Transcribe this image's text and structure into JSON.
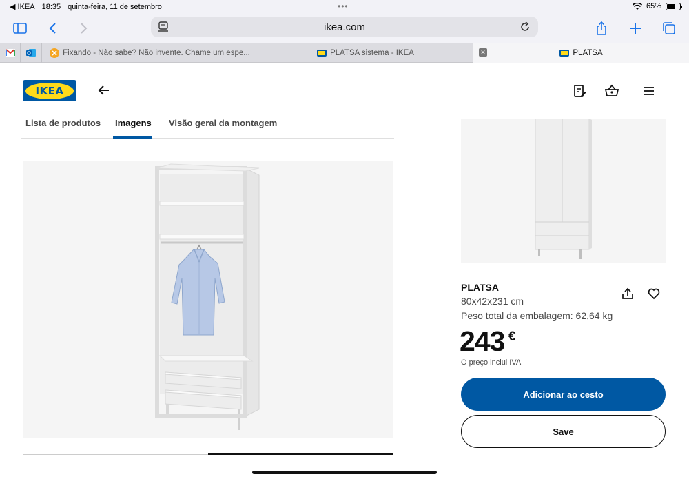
{
  "status": {
    "back_app": "◀ IKEA",
    "time": "18:35",
    "date": "quinta-feira, 11 de setembro",
    "battery": "65%",
    "battery_level": 0.65
  },
  "browser": {
    "url": "ikea.com",
    "tabs": [
      {
        "title": "",
        "favicon": "gmail"
      },
      {
        "title": "",
        "favicon": "outlook"
      },
      {
        "title": "Fixando - Não sabe? Não invente. Chame um espe...",
        "favicon": "fixando"
      },
      {
        "title": "PLATSA sistema - IKEA",
        "favicon": "ikea"
      },
      {
        "title": "PLATSA",
        "favicon": "ikea",
        "active": true
      }
    ]
  },
  "header": {
    "logo_text": "IKEA"
  },
  "subnav": {
    "tabs": [
      "Lista de produtos",
      "Imagens",
      "Visão geral da montagem"
    ],
    "active_index": 1
  },
  "gallery": {
    "progress": 0.5
  },
  "product": {
    "name": "PLATSA",
    "dimensions": "80x42x231 cm",
    "weight": "Peso total da embalagem: 62,64 kg",
    "price": "243",
    "currency": "€",
    "vat_note": "O preço inclui IVA",
    "add_to_cart": "Adicionar ao cesto",
    "save": "Save"
  },
  "colors": {
    "ikea_blue": "#0058a3",
    "ikea_yellow": "#ffda1a",
    "safari_blue": "#1a73e8"
  }
}
